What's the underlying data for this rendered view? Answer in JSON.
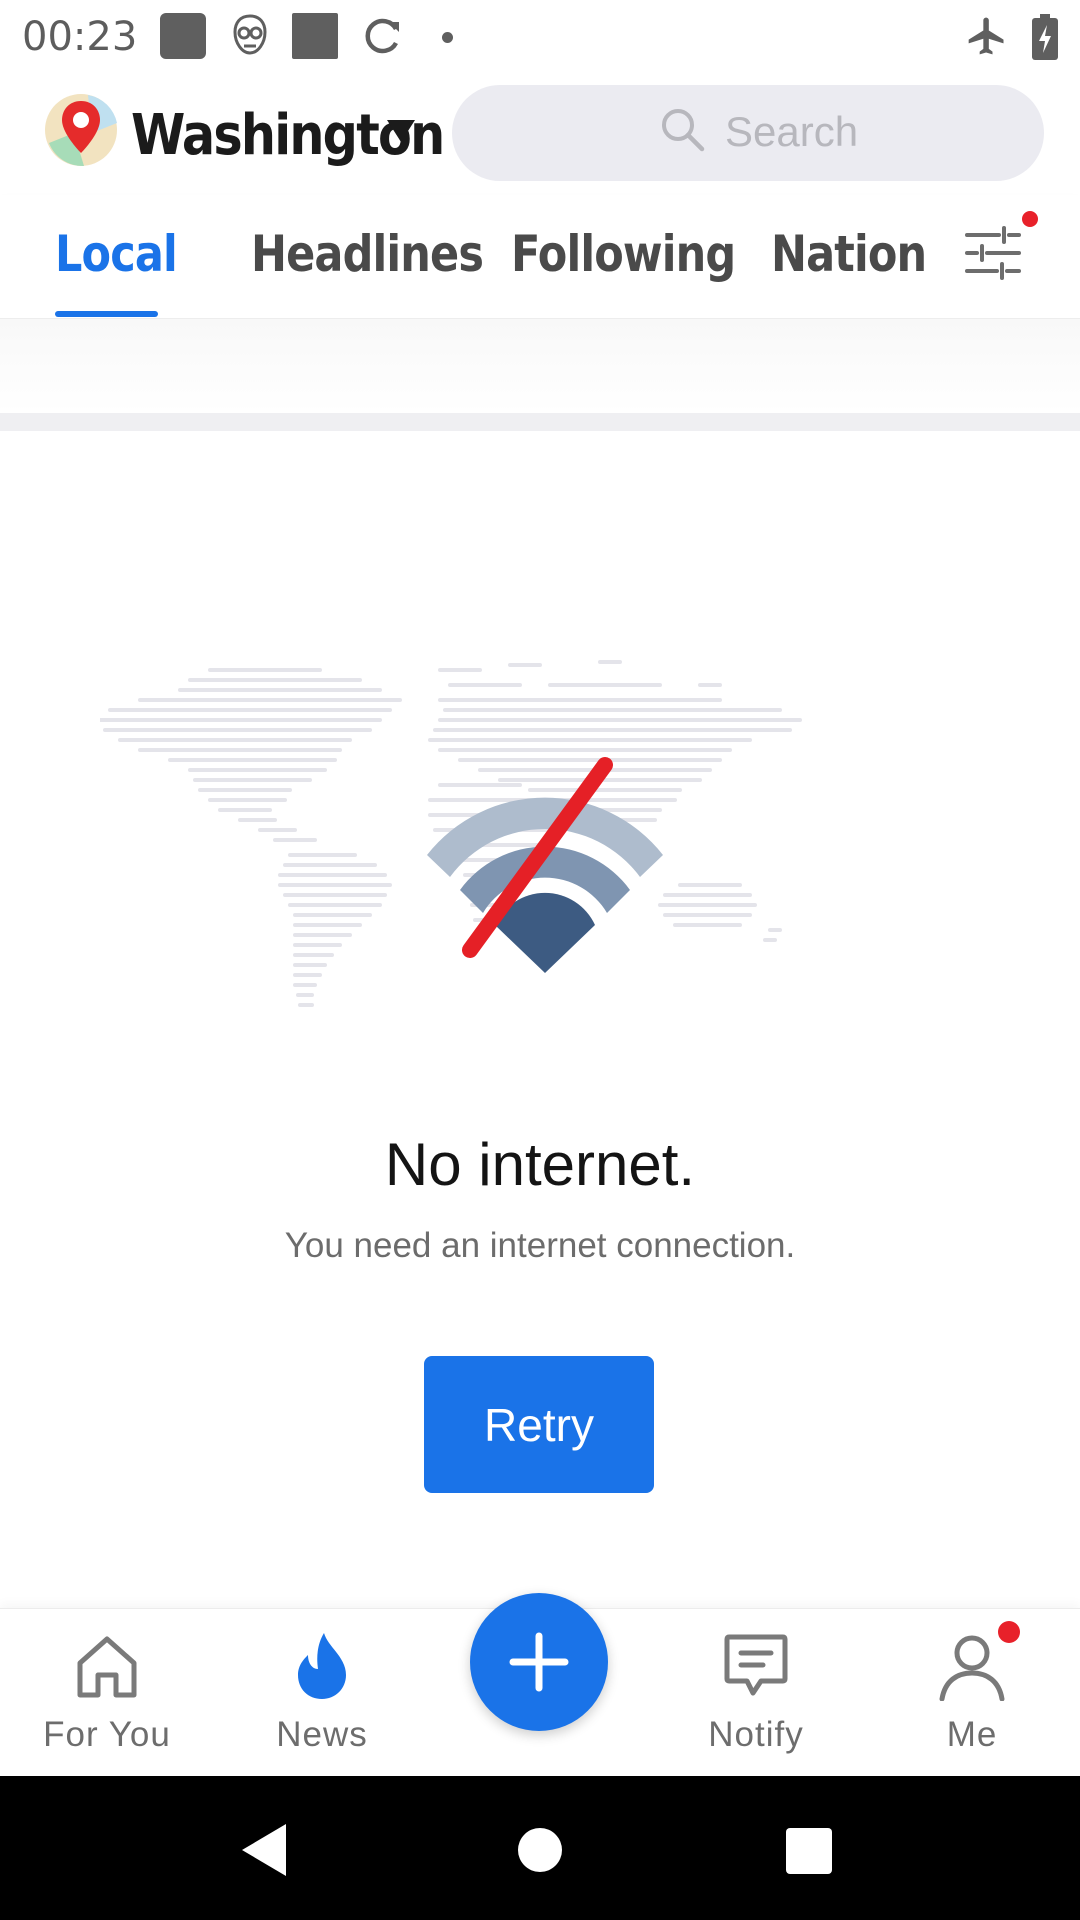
{
  "status_bar": {
    "time": "00:23",
    "icons": [
      "app-square-icon",
      "mascot-icon",
      "app-square-icon",
      "sync-icon",
      "dot-icon",
      "airplane-mode-icon",
      "battery-charging-icon"
    ]
  },
  "header": {
    "location": "Washington",
    "search_placeholder": "Search"
  },
  "tabs": [
    {
      "label": "Local",
      "active": true
    },
    {
      "label": "Headlines",
      "active": false
    },
    {
      "label": "Following",
      "active": false
    },
    {
      "label": "Nation",
      "active": false
    }
  ],
  "empty_state": {
    "title": "No internet.",
    "subtitle": "You need an internet connection.",
    "retry_label": "Retry"
  },
  "bottom_nav": {
    "items": [
      {
        "label": "For You",
        "icon": "home-icon",
        "active": false
      },
      {
        "label": "News",
        "icon": "flame-icon",
        "active": true
      },
      {
        "label": "Notify",
        "icon": "message-icon",
        "active": false
      },
      {
        "label": "Me",
        "icon": "person-icon",
        "active": false
      }
    ],
    "fab_icon": "plus-icon"
  },
  "colors": {
    "accent": "#1a73e8",
    "badge": "#e8212a",
    "wifi_light": "#aebccd",
    "wifi_dark": "#3d5b82"
  }
}
